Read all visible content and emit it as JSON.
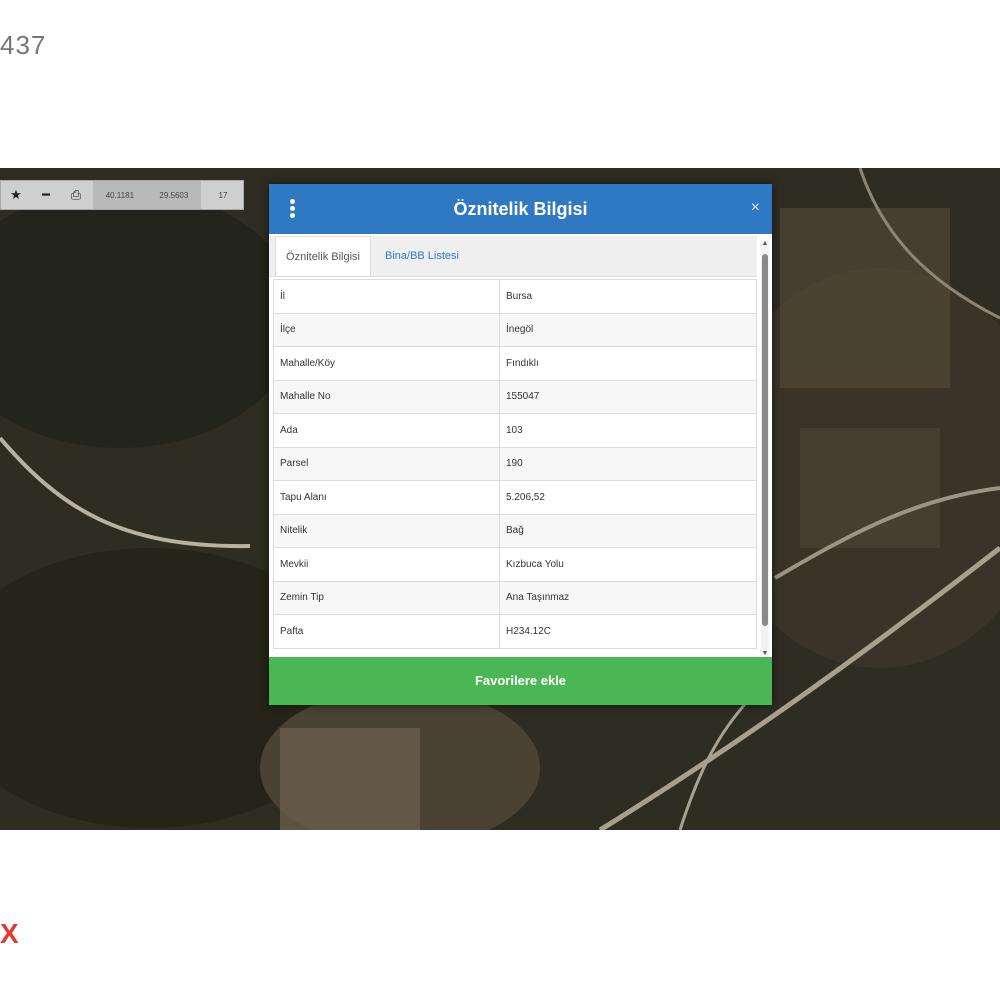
{
  "page": {
    "corner_text": "437",
    "corner_mark": "X"
  },
  "toolbar": {
    "icons": [
      "star-icon",
      "minus-icon",
      "print-icon"
    ],
    "coord_lat": "40.1181",
    "coord_lon": "29.5603",
    "zoom": "17"
  },
  "dialog": {
    "title": "Öznitelik Bilgisi",
    "close_symbol": "×",
    "tabs": [
      {
        "label": "Öznitelik Bilgisi"
      },
      {
        "label": "Bina/BB Listesi"
      }
    ],
    "rows": [
      {
        "key": "İl",
        "value": "Bursa"
      },
      {
        "key": "İlçe",
        "value": "İnegöl"
      },
      {
        "key": "Mahalle/Köy",
        "value": "Fındıklı"
      },
      {
        "key": "Mahalle No",
        "value": "155047"
      },
      {
        "key": "Ada",
        "value": "103"
      },
      {
        "key": "Parsel",
        "value": "190"
      },
      {
        "key": "Tapu Alanı",
        "value": "5.206,52"
      },
      {
        "key": "Nitelik",
        "value": "Bağ"
      },
      {
        "key": "Mevkii",
        "value": "Kızbuca Yolu"
      },
      {
        "key": "Zemin Tip",
        "value": "Ana Taşınmaz"
      },
      {
        "key": "Pafta",
        "value": "H234.12C"
      }
    ],
    "favorites_button": "Favorilere ekle"
  },
  "colors": {
    "header": "#2f79c2",
    "button": "#4bb654"
  }
}
